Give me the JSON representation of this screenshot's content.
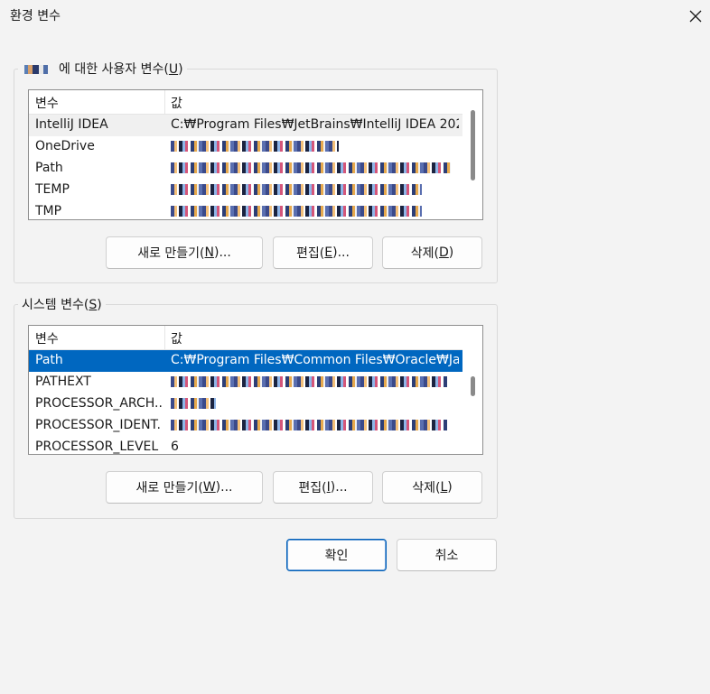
{
  "window": {
    "title": "환경 변수"
  },
  "user_group": {
    "legend": "에 대한 사용자 변수(U)",
    "legend_pre": "에 대한 사용자 변수(",
    "legend_key": "U",
    "legend_post": ")",
    "columns": {
      "name": "변수",
      "value": "값"
    },
    "rows": [
      {
        "name": "IntelliJ IDEA",
        "value": "C:₩Program Files₩JetBrains₩IntelliJ IDEA 202..."
      },
      {
        "name": "OneDrive",
        "value": ""
      },
      {
        "name": "Path",
        "value": ""
      },
      {
        "name": "TEMP",
        "value": ""
      },
      {
        "name": "TMP",
        "value": ""
      }
    ],
    "buttons": {
      "new": {
        "pre": "새로 만들기(",
        "key": "N",
        "post": ")..."
      },
      "edit": {
        "pre": "편집(",
        "key": "E",
        "post": ")..."
      },
      "delete": {
        "pre": "삭제(",
        "key": "D",
        "post": ")"
      }
    }
  },
  "system_group": {
    "legend_pre": "시스템 변수(",
    "legend_key": "S",
    "legend_post": ")",
    "columns": {
      "name": "변수",
      "value": "값"
    },
    "rows": [
      {
        "name": "Path",
        "value": "C:₩Program Files₩Common Files₩Oracle₩Ja..."
      },
      {
        "name": "PATHEXT",
        "value": ""
      },
      {
        "name": "PROCESSOR_ARCH...",
        "value": ""
      },
      {
        "name": "PROCESSOR_IDENT...",
        "value": ""
      },
      {
        "name": "PROCESSOR_LEVEL",
        "value": "6"
      }
    ],
    "buttons": {
      "new": {
        "pre": "새로 만들기(",
        "key": "W",
        "post": ")..."
      },
      "edit": {
        "pre": "편집(",
        "key": "I",
        "post": ")..."
      },
      "delete": {
        "pre": "삭제(",
        "key": "L",
        "post": ")"
      }
    }
  },
  "dialog_buttons": {
    "ok": "확인",
    "cancel": "취소"
  },
  "icons": {
    "close": "close-icon"
  }
}
